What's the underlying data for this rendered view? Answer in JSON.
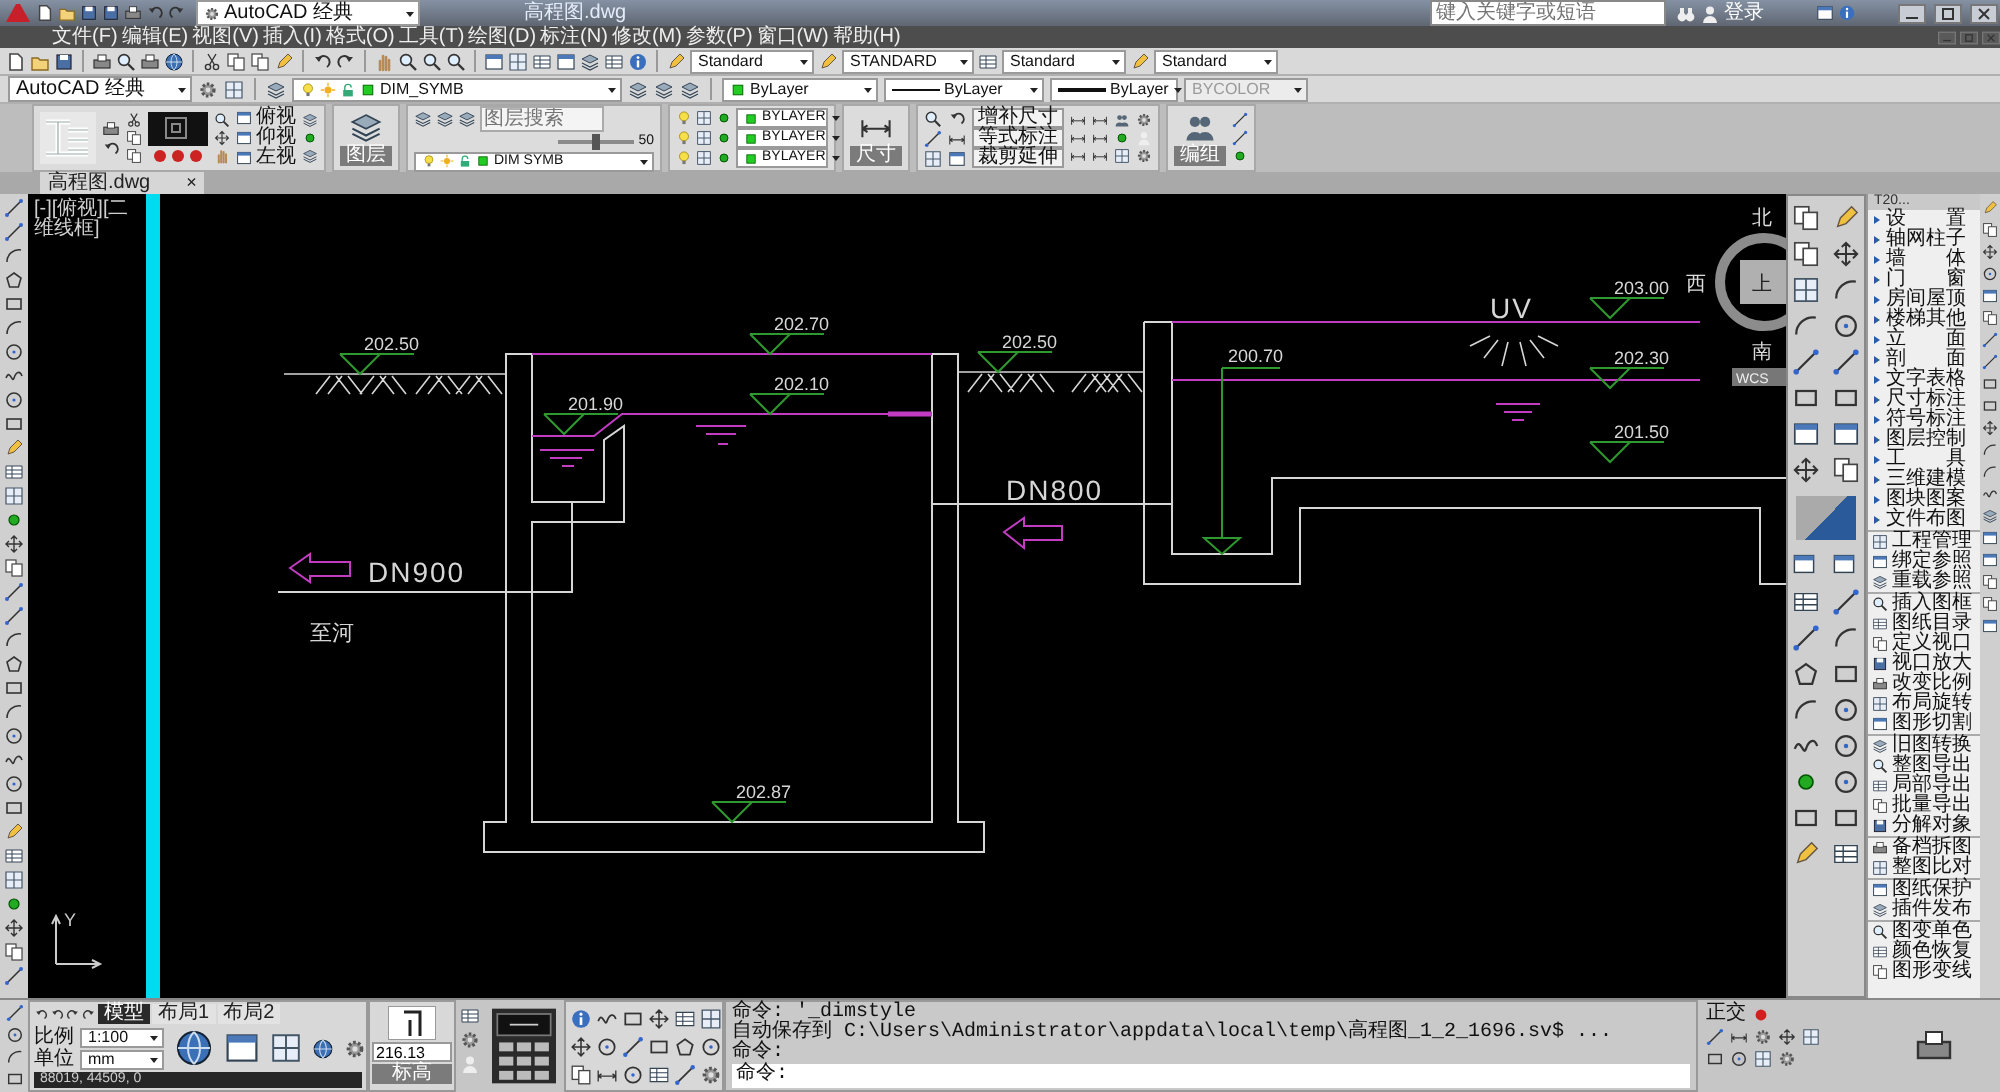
{
  "title_bar": {
    "workspace": "AutoCAD 经典",
    "document": "高程图.dwg",
    "search_placeholder": "键入关键字或短语",
    "sign_in": "登录"
  },
  "menu": [
    "文件(F)",
    "编辑(E)",
    "视图(V)",
    "插入(I)",
    "格式(O)",
    "工具(T)",
    "绘图(D)",
    "标注(N)",
    "修改(M)",
    "参数(P)",
    "窗口(W)",
    "帮助(H)"
  ],
  "styles_toolbar": [
    "Standard",
    "STANDARD",
    "Standard",
    "Standard"
  ],
  "properties_toolbar": {
    "workspace": "AutoCAD 经典",
    "layer": "DIM_SYMB",
    "color_setting": "ByLayer",
    "linetype": "ByLayer",
    "lineweight": "ByLayer",
    "plot_style": {
      "text": "BYCOLOR",
      "disabled": true
    }
  },
  "ribbon": {
    "views": [
      "俯视",
      "仰视",
      "左视"
    ],
    "layer_button": "图层",
    "layer_search_placeholder": "图层搜索",
    "slider": {
      "level": 0.5,
      "reading": "50"
    },
    "layer_combo": "DIM SYMB",
    "layer_properties": [
      "BYLAYER",
      "BYLAYER",
      "BYLAYER"
    ],
    "dimension_button": "尺寸",
    "dimension_tools": [
      "增补尺寸",
      "等式标注",
      "裁剪延伸"
    ],
    "group_button": "编组"
  },
  "document_tab": {
    "label": "高程图.dwg",
    "close": "×"
  },
  "viewport_label": "[-][俯视][二维线框]",
  "drawing": {
    "elevations": [
      "202.50",
      "202.70",
      "202.10",
      "201.90",
      "202.50",
      "202.87",
      "200.70",
      "203.00",
      "202.30",
      "201.50"
    ],
    "pipes": [
      "DN900",
      "DN800"
    ],
    "outlet_note": "至河",
    "lamp_label": "UV",
    "compass": [
      "北",
      "西",
      "上",
      "南"
    ],
    "ucs_label": "WCS",
    "axis_label": "Y"
  },
  "t20_palette": {
    "title": "T20...",
    "menu": [
      "设 置",
      "轴网柱子",
      "墙 体",
      "门 窗",
      "房间屋顶",
      "楼梯其他",
      "立 面",
      "剖 面",
      "文字表格",
      "尺寸标注",
      "符号标注",
      "图层控制",
      "工 具",
      "三维建模",
      "图块图案",
      "文件布图"
    ],
    "tool_groups": [
      [
        "工程管理",
        "绑定参照",
        "重载参照"
      ],
      [
        "插入图框",
        "图纸目录",
        "定义视口",
        "视口放大",
        "改变比例",
        "布局旋转",
        "图形切割"
      ],
      [
        "旧图转换",
        "整图导出",
        "局部导出",
        "批量导出",
        "分解对象"
      ],
      [
        "备档拆图",
        "整图比对"
      ],
      [
        "图纸保护",
        "插件发布"
      ],
      [
        "图变单色",
        "颜色恢复",
        "图形变线"
      ]
    ]
  },
  "layout_tabs": [
    {
      "label": "模型",
      "selected": true
    },
    {
      "label": "布局1",
      "selected": false
    },
    {
      "label": "布局2",
      "selected": false
    }
  ],
  "scale": {
    "label": "比例",
    "value": "1:100"
  },
  "units": {
    "label": "单位",
    "value": "mm"
  },
  "coordinates": "88019, 44509, 0",
  "elevation_tool": {
    "value": "216.13",
    "button": "标高"
  },
  "command_history": [
    "命令: '_dimstyle",
    "自动保存到 C:\\Users\\Administrator\\appdata\\local\\temp\\高程图_1_2_1696.sv$ ...",
    "命令:"
  ],
  "command_prompt": "命令:",
  "status": [
    "正交"
  ]
}
